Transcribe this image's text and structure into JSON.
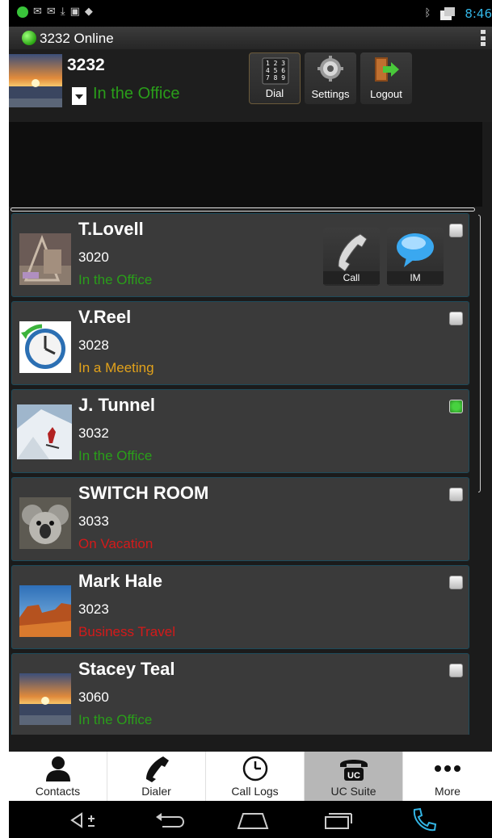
{
  "status_bar": {
    "time": "8:46"
  },
  "app_bar": {
    "online_text": "3232 Online"
  },
  "user": {
    "extension": "3232",
    "status": "In the Office"
  },
  "header_buttons": {
    "dial": "Dial",
    "settings": "Settings",
    "logout": "Logout",
    "dial_pad": [
      "1 2 3",
      "4 5 6",
      "7 8 9"
    ]
  },
  "contact_actions": {
    "call": "Call",
    "im": "IM"
  },
  "contacts": [
    {
      "name": "T.Lovell",
      "ext": "3020",
      "status": "In the Office",
      "status_color": "#2a9e1a",
      "checked": false
    },
    {
      "name": "V.Reel",
      "ext": "3028",
      "status": "In a Meeting",
      "status_color": "#e2a21b",
      "checked": false
    },
    {
      "name": "J. Tunnel",
      "ext": "3032",
      "status": "In the Office",
      "status_color": "#2a9e1a",
      "checked": true
    },
    {
      "name": "SWITCH ROOM",
      "ext": "3033",
      "status": "On Vacation",
      "status_color": "#d41a1a",
      "checked": false
    },
    {
      "name": "Mark Hale",
      "ext": "3023",
      "status": "Business Travel",
      "status_color": "#d41a1a",
      "checked": false
    },
    {
      "name": "Stacey Teal",
      "ext": "3060",
      "status": "In the Office",
      "status_color": "#2a9e1a",
      "checked": false
    }
  ],
  "tabs": [
    {
      "label": "Contacts",
      "icon": "person-icon"
    },
    {
      "label": "Dialer",
      "icon": "phone-handset-icon"
    },
    {
      "label": "Call Logs",
      "icon": "clock-icon"
    },
    {
      "label": "UC Suite",
      "icon": "uc-phone-icon"
    },
    {
      "label": "More",
      "icon": "more-dots-icon"
    }
  ],
  "colors": {
    "online": "#2a9e1a",
    "meeting": "#e2a21b",
    "away": "#d41a1a",
    "accent": "#33b5e5"
  }
}
